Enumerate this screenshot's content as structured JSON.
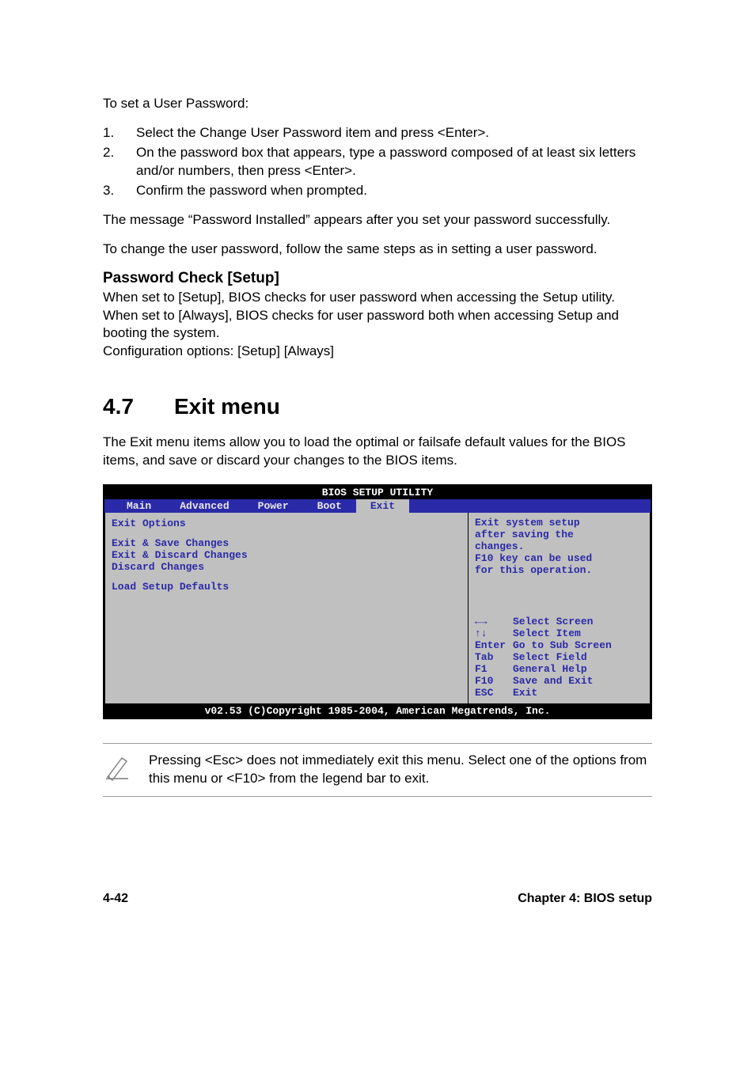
{
  "intro": {
    "set_user_pw": "To set a User Password:",
    "steps": [
      "Select the Change User Password item and press <Enter>.",
      "On the password box that appears, type a password composed of at least six letters and/or numbers, then press <Enter>.",
      "Confirm the password when prompted."
    ],
    "msg_installed": "The message “Password Installed” appears after you set your password successfully.",
    "change_pw": "To change the user password, follow the same steps as in setting a user password."
  },
  "pw_check": {
    "heading": "Password Check [Setup]",
    "body1": "When set to [Setup], BIOS checks for user password when accessing the Setup utility. When set to [Always], BIOS checks for user password both when accessing Setup and booting the system.",
    "body2": "Configuration options: [Setup] [Always]"
  },
  "section": {
    "num": "4.7",
    "title": "Exit menu",
    "desc": "The Exit menu items allow you to load the optimal or failsafe default values for the BIOS items, and save or discard your changes to the BIOS items."
  },
  "bios": {
    "title": "BIOS SETUP UTILITY",
    "tabs": [
      "Main",
      "Advanced",
      "Power",
      "Boot",
      "Exit"
    ],
    "active_tab": "Exit",
    "left": {
      "heading": "Exit Options",
      "group1": [
        "Exit & Save Changes",
        "Exit & Discard Changes",
        "Discard Changes"
      ],
      "group2": [
        "Load Setup Defaults"
      ]
    },
    "right": {
      "help": [
        "Exit system setup",
        "after saving the",
        "changes.",
        "F10 key can be used",
        "for this operation."
      ],
      "hints": [
        {
          "key": "arrows-lr",
          "label": "Select Screen"
        },
        {
          "key": "arrows-ud",
          "label": "Select Item"
        },
        {
          "key": "Enter",
          "label": "Go to Sub Screen"
        },
        {
          "key": "Tab",
          "label": "Select Field"
        },
        {
          "key": "F1",
          "label": "General Help"
        },
        {
          "key": "F10",
          "label": "Save and Exit"
        },
        {
          "key": "ESC",
          "label": "Exit"
        }
      ]
    },
    "footer": "v02.53 (C)Copyright 1985-2004, American Megatrends, Inc."
  },
  "note": {
    "text": "Pressing <Esc> does not immediately exit this menu. Select one of the options from this menu or <F10> from the legend bar to exit."
  },
  "footer": {
    "left": "4-42",
    "right": "Chapter 4: BIOS setup"
  }
}
